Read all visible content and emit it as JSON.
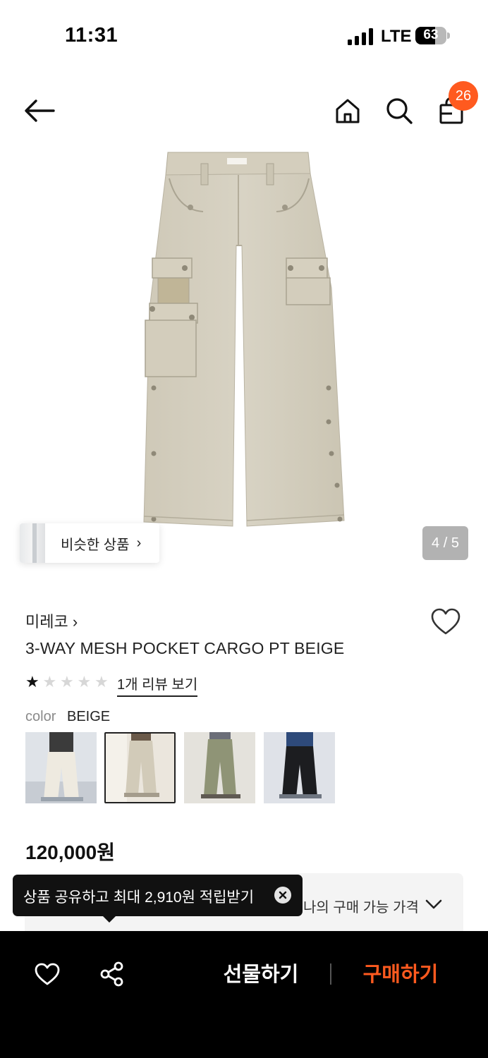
{
  "status_bar": {
    "time": "11:31",
    "network": "LTE",
    "battery": "63",
    "battery_level": 0.63
  },
  "header": {
    "back_icon": "arrow-left-icon",
    "home_icon": "home-icon",
    "search_icon": "search-icon",
    "cart_icon": "shopping-bag-icon",
    "cart_count": "26",
    "badge_color": "#ff5a1f"
  },
  "gallery": {
    "similar_label": "비슷한 상품",
    "similar_chevron": "›",
    "page_indicator": "4 / 5",
    "current_page": 4,
    "total_pages": 5
  },
  "product": {
    "brand": "미레코 ›",
    "name": "3-WAY MESH POCKET CARGO PT BEIGE",
    "rating": 1,
    "rating_max": 5,
    "review_link": "1개 리뷰 보기",
    "color_label": "color",
    "color_value": "BEIGE",
    "swatches": [
      {
        "color": "white",
        "selected": false
      },
      {
        "color": "beige",
        "selected": true
      },
      {
        "color": "khaki",
        "selected": false
      },
      {
        "color": "black",
        "selected": false
      }
    ],
    "price": "120,000원"
  },
  "purchase_price": {
    "label": "나의 구매 가능 가격",
    "icon": "chevron-down-icon"
  },
  "tooltip": {
    "text": "상품 공유하고 최대 2,910원 적립받기",
    "close_icon": "close-icon"
  },
  "bottom_bar": {
    "like_icon": "heart-icon",
    "share_icon": "share-icon",
    "gift_label": "선물하기",
    "buy_label": "구매하기",
    "buy_color": "#ff5a1f"
  }
}
